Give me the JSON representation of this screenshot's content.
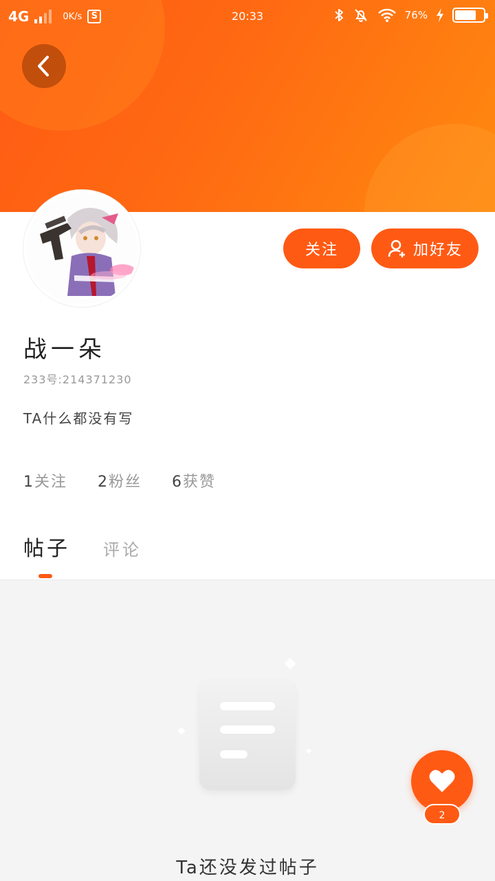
{
  "status_bar": {
    "network": "4G",
    "speed": "0K/s",
    "s_badge": "S",
    "time": "20:33",
    "battery": "76%",
    "battery_level": 0.76
  },
  "profile": {
    "name": "战一朵",
    "id_label": "233号:214371230",
    "bio": "TA什么都没有写"
  },
  "buttons": {
    "follow": "关注",
    "add_friend": "加好友"
  },
  "stats": [
    {
      "num": "1",
      "label": "关注"
    },
    {
      "num": "2",
      "label": "粉丝"
    },
    {
      "num": "6",
      "label": "获赞"
    }
  ],
  "tabs": [
    {
      "label": "帖子",
      "active": true
    },
    {
      "label": "评论",
      "active": false
    }
  ],
  "empty_state": {
    "text": "Ta还没发过帖子"
  },
  "like_fab": {
    "count": "2"
  },
  "colors": {
    "accent": "#ff5a14",
    "banner_end": "#ff8a10"
  }
}
